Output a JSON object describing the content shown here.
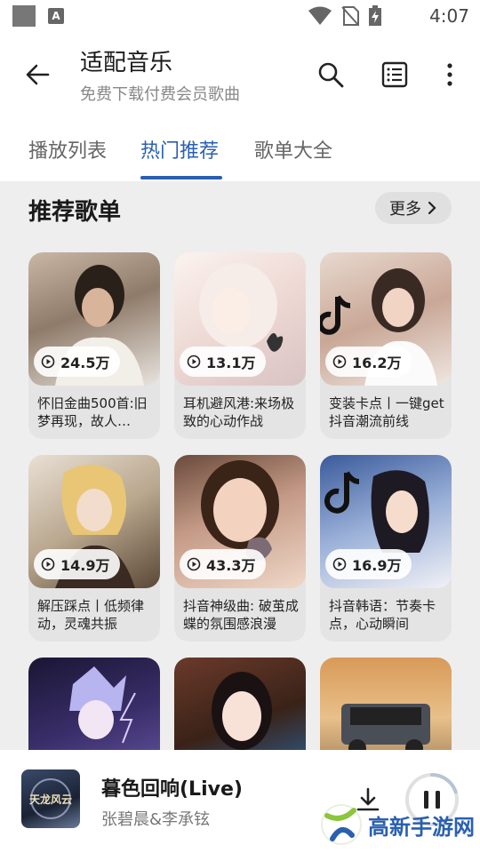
{
  "status_bar": {
    "time": "4:07"
  },
  "header": {
    "title": "适配音乐",
    "subtitle": "免费下载付费会员歌曲"
  },
  "tabs": [
    {
      "label": "播放列表",
      "active": false
    },
    {
      "label": "热门推荐",
      "active": true
    },
    {
      "label": "歌单大全",
      "active": false
    }
  ],
  "section": {
    "title": "推荐歌单",
    "more_label": "更多"
  },
  "playlists": [
    {
      "plays": "24.5万",
      "title": "怀旧金曲500首:旧梦再现，故人…"
    },
    {
      "plays": "13.1万",
      "title": "耳机避风港:来场极致的心动作战"
    },
    {
      "plays": "16.2万",
      "title": "变装卡点丨一键get抖音潮流前线"
    },
    {
      "plays": "14.9万",
      "title": "解压踩点丨低频律动，灵魂共振"
    },
    {
      "plays": "43.3万",
      "title": "抖音神级曲: 破茧成蝶的氛围感浪漫"
    },
    {
      "plays": "16.9万",
      "title": "抖音韩语：节奏卡点，心动瞬间"
    }
  ],
  "player": {
    "song_title": "暮色回响(Live)",
    "artist": "张碧晨&李承铉",
    "art_label": "天龙风云",
    "progress": 0.2
  },
  "watermark": {
    "text": "高新手游网"
  },
  "colors": {
    "accent": "#2a5fb0",
    "background": "#eeeeee"
  }
}
